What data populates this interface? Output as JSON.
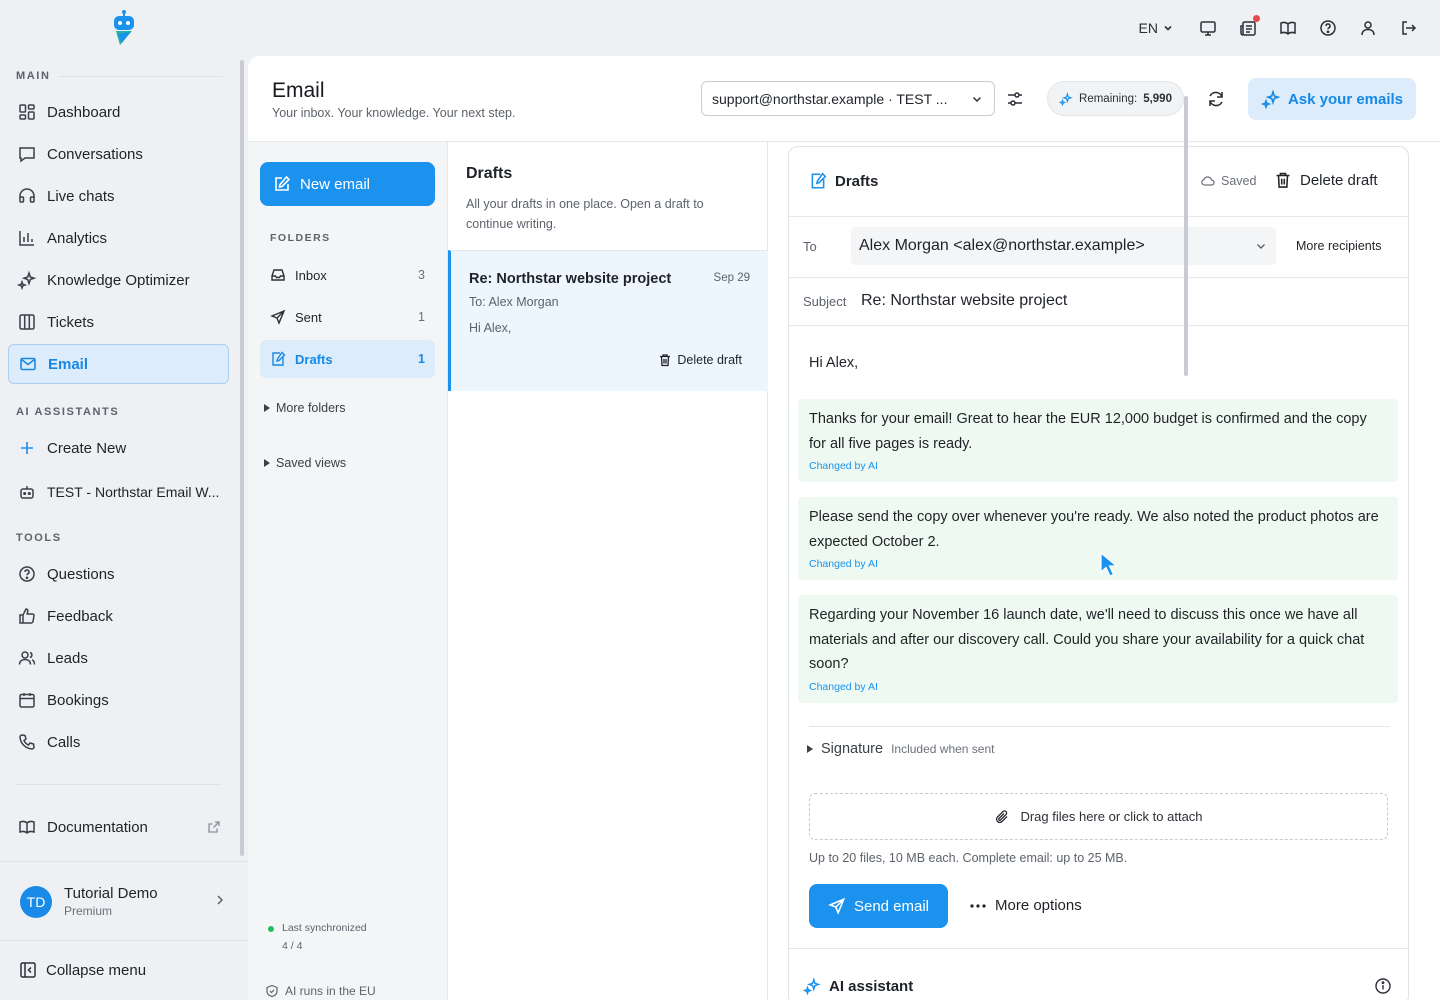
{
  "topbar": {
    "language": "EN"
  },
  "sidebar": {
    "sections": {
      "main": "MAIN",
      "ai_assistants": "AI ASSISTANTS",
      "tools": "TOOLS"
    },
    "main_items": [
      {
        "label": "Dashboard",
        "icon": "grid-icon"
      },
      {
        "label": "Conversations",
        "icon": "chat-icon"
      },
      {
        "label": "Live chats",
        "icon": "headset-icon"
      },
      {
        "label": "Analytics",
        "icon": "bar-chart-icon"
      },
      {
        "label": "Knowledge Optimizer",
        "icon": "sparkle-icon"
      },
      {
        "label": "Tickets",
        "icon": "columns-icon"
      },
      {
        "label": "Email",
        "icon": "mail-icon"
      }
    ],
    "ai_items": [
      {
        "label": "Create New",
        "icon": "plus-icon"
      },
      {
        "label": "TEST - Northstar Email W...",
        "icon": "bot-icon"
      }
    ],
    "tool_items": [
      {
        "label": "Questions",
        "icon": "question-icon"
      },
      {
        "label": "Feedback",
        "icon": "thumbs-up-icon"
      },
      {
        "label": "Leads",
        "icon": "users-icon"
      },
      {
        "label": "Bookings",
        "icon": "calendar-icon"
      },
      {
        "label": "Calls",
        "icon": "phone-icon"
      }
    ],
    "documentation": "Documentation",
    "profile": {
      "initials": "TD",
      "name": "Tutorial Demo",
      "plan": "Premium"
    },
    "collapse": "Collapse menu"
  },
  "header": {
    "title": "Email",
    "subtitle": "Your inbox. Your knowledge. Your next step.",
    "account": "support@northstar.example · TEST ...",
    "remaining_label": "Remaining:",
    "remaining_value": "5,990",
    "ask_label": "Ask your emails"
  },
  "folders": {
    "new_email": "New email",
    "heading": "FOLDERS",
    "items": [
      {
        "label": "Inbox",
        "count": "3",
        "icon": "inbox-icon"
      },
      {
        "label": "Sent",
        "count": "1",
        "icon": "send-icon"
      },
      {
        "label": "Drafts",
        "count": "1",
        "icon": "draft-icon"
      }
    ],
    "more_folders": "More folders",
    "saved_views": "Saved views",
    "sync_label": "Last synchronized",
    "sync_value": "4 / 4",
    "ai_eu": "AI runs in the EU"
  },
  "list": {
    "title": "Drafts",
    "description": "All your drafts in one place. Open a draft to continue writing.",
    "drafts": [
      {
        "subject": "Re: Northstar website project",
        "date": "Sep 29",
        "to": "To: Alex Morgan",
        "preview": "Hi Alex,",
        "delete_label": "Delete draft"
      }
    ]
  },
  "editor": {
    "title": "Drafts",
    "saved": "Saved",
    "delete_label": "Delete draft",
    "to_label": "To",
    "to_value": "Alex Morgan <alex@northstar.example>",
    "more_recipients": "More recipients",
    "subject_label": "Subject",
    "subject_value": "Re: Northstar website project",
    "greeting": "Hi Alex,",
    "paragraphs": [
      {
        "text": "Thanks for your email! Great to hear the EUR 12,000 budget is confirmed and the copy for all five pages is ready.",
        "tag": "Changed by AI"
      },
      {
        "text": "Please send the copy over whenever you're ready. We also noted the product photos are expected October 2.",
        "tag": "Changed by AI"
      },
      {
        "text": "Regarding your November 16 launch date, we'll need to discuss this once we have all materials and after our discovery call. Could you share your availability for a quick chat soon?",
        "tag": "Changed by AI"
      }
    ],
    "signature_label": "Signature",
    "signature_note": "Included when sent",
    "attach_label": "Drag files here or click to attach",
    "limits": "Up to 20 files, 10 MB each. Complete email: up to 25 MB.",
    "send_label": "Send email",
    "more_options": "More options",
    "ai_assistant": "AI assistant"
  },
  "colors": {
    "accent": "#1a92ee",
    "accent_soft": "#dcecfb",
    "ai_change_bg": "#eefaf1",
    "notification": "#e5484d",
    "online": "#1fbf5f"
  }
}
